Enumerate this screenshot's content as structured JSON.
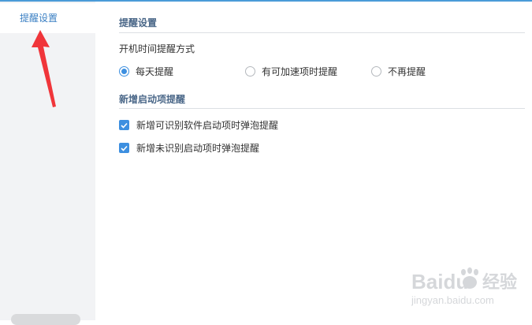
{
  "sidebar": {
    "items": [
      {
        "label": "提醒设置"
      }
    ]
  },
  "main": {
    "section1": {
      "title": "提醒设置",
      "subtitle": "开机时间提醒方式",
      "options": [
        {
          "label": "每天提醒",
          "selected": true
        },
        {
          "label": "有可加速项时提醒",
          "selected": false
        },
        {
          "label": "不再提醒",
          "selected": false
        }
      ]
    },
    "section2": {
      "title": "新增启动项提醒",
      "checkboxes": [
        {
          "label": "新增可识别软件启动项时弹泡提醒",
          "checked": true
        },
        {
          "label": "新增未识别启动项时弹泡提醒",
          "checked": true
        }
      ]
    }
  },
  "watermark": {
    "brand": "Baidu",
    "suffix": "经验",
    "url": "jingyan.baidu.com"
  },
  "colors": {
    "accent": "#3d8fe0",
    "arrow": "#f0353a",
    "title": "#4a6788"
  }
}
